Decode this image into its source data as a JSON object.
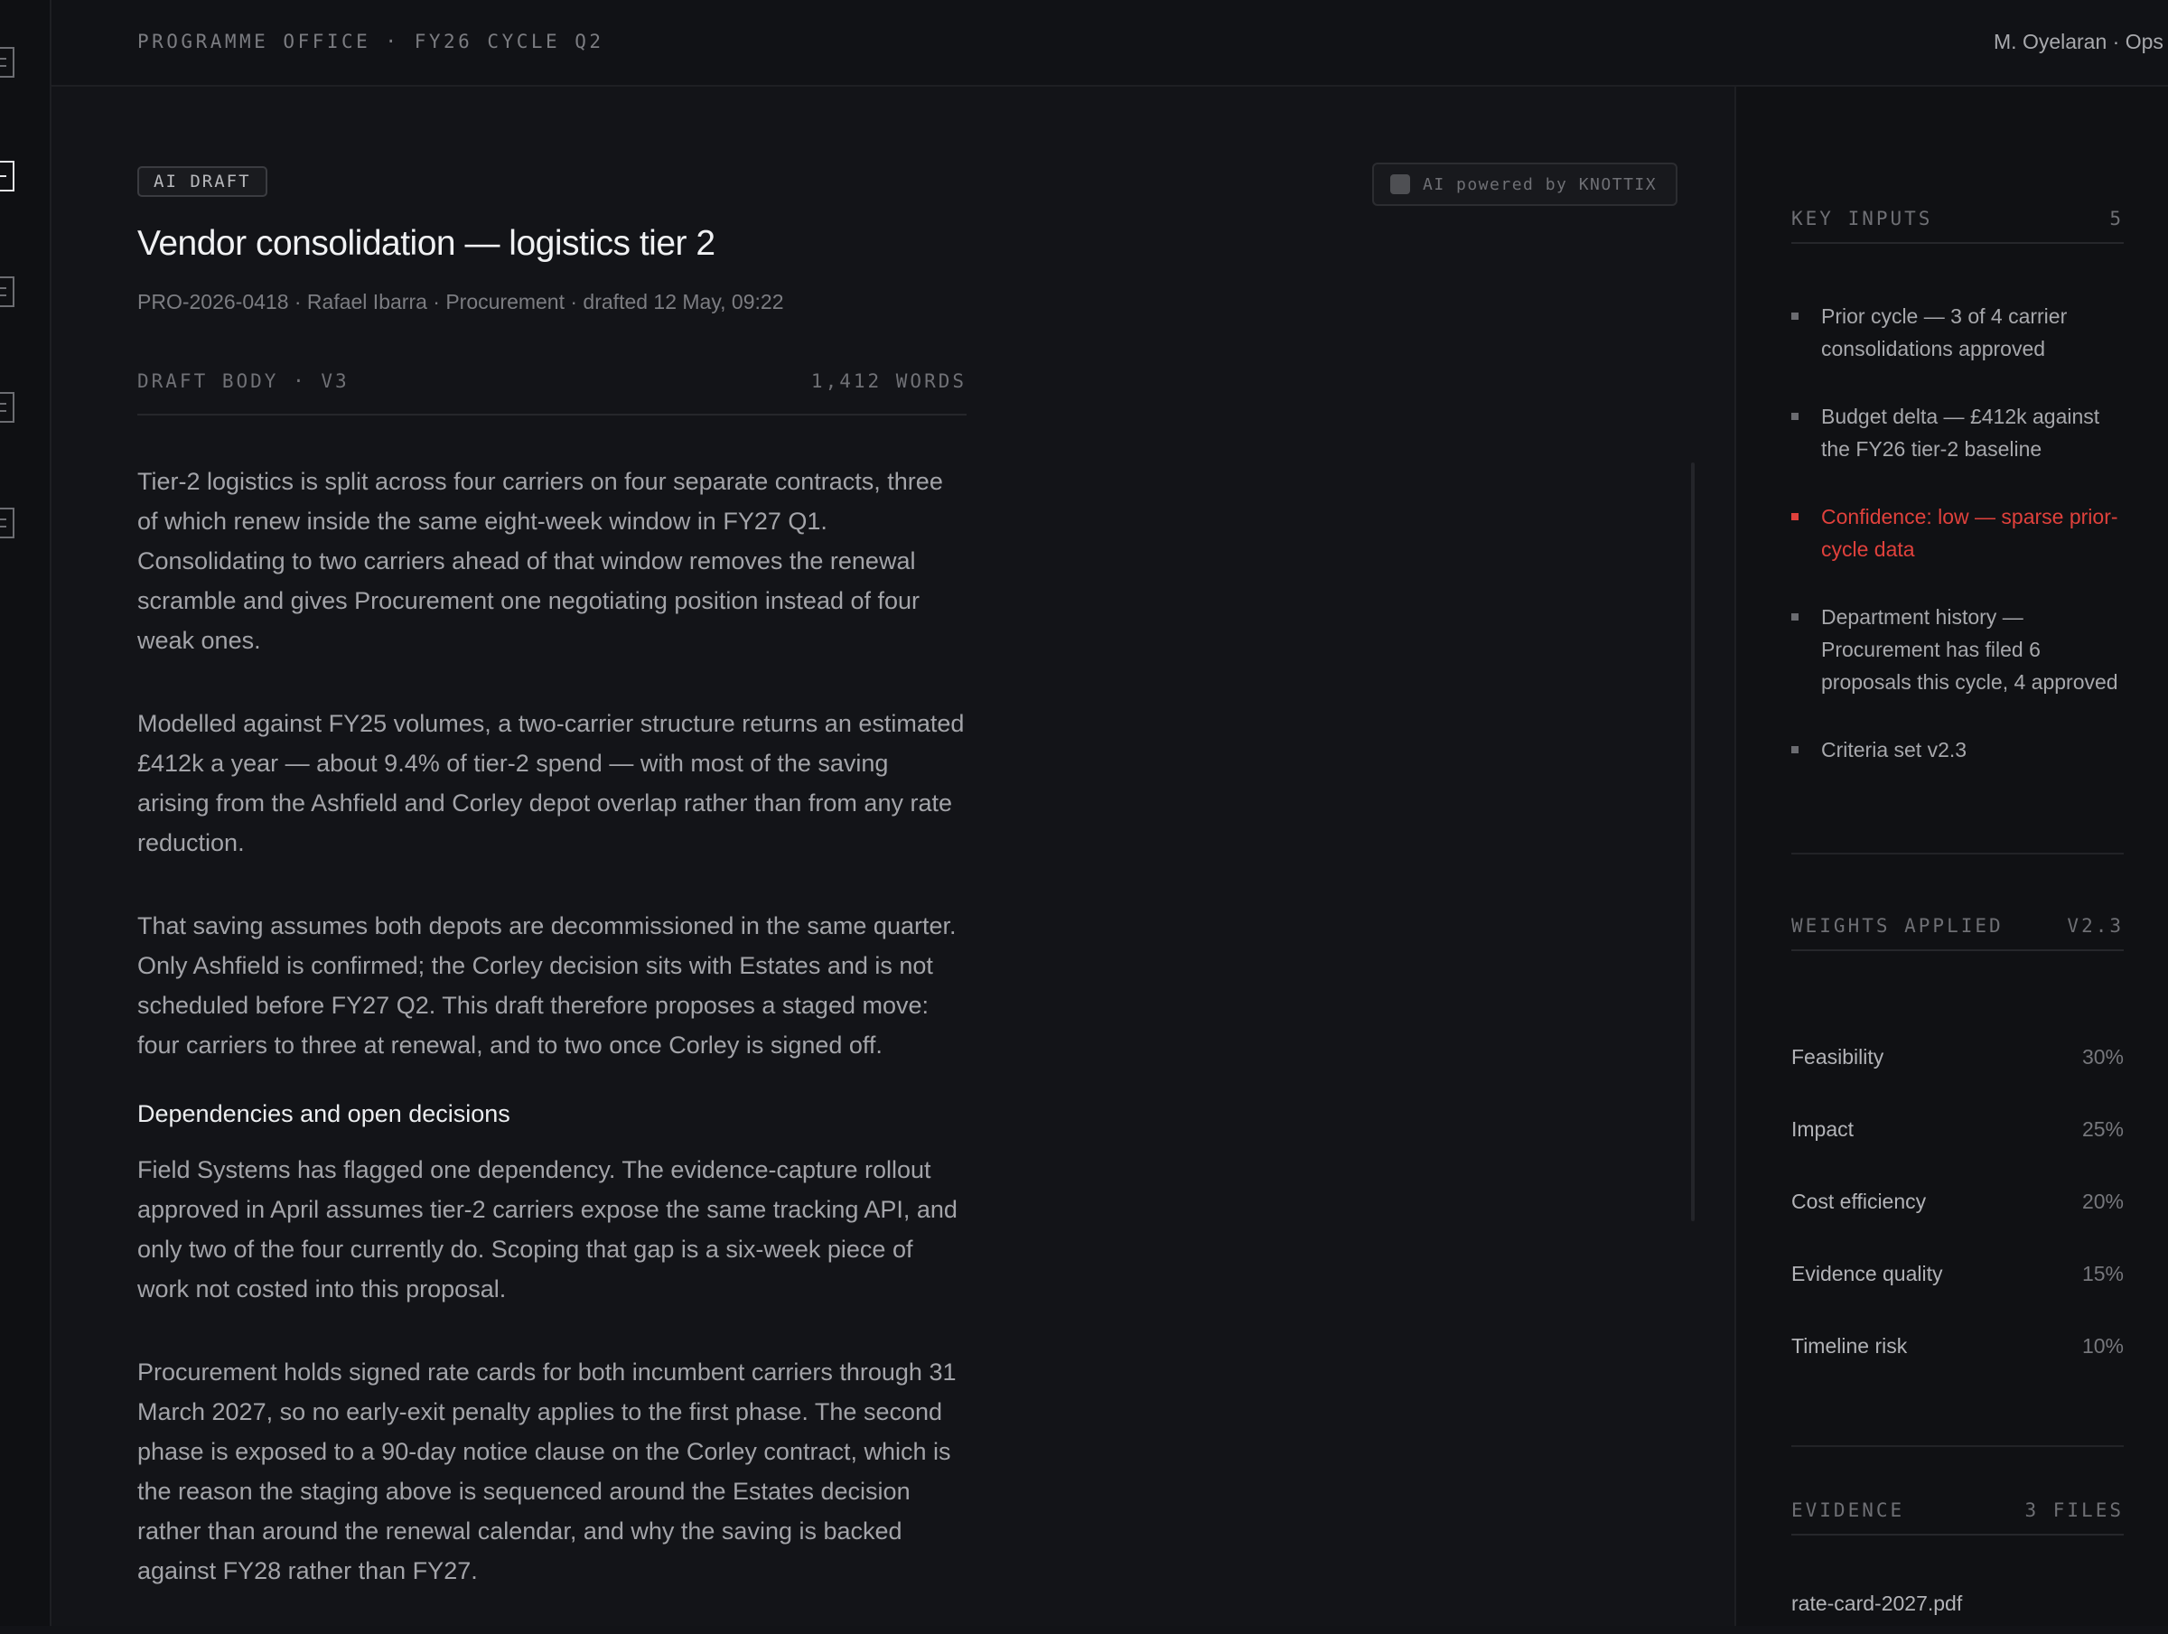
{
  "header": {
    "breadcrumb": "PROGRAMME OFFICE · FY26 CYCLE Q2",
    "user": "M. Oyelaran · Ops"
  },
  "rail": {
    "icons": [
      "list-icon",
      "active-nav-icon",
      "list-icon",
      "list-icon",
      "list-icon"
    ]
  },
  "draft": {
    "badge": "AI DRAFT",
    "powered_by": "AI powered by KNOTTIX",
    "title": "Vendor consolidation — logistics tier 2",
    "meta": "PRO-2026-0418 · Rafael Ibarra · Procurement · drafted 12 May, 09:22",
    "body_label": "DRAFT BODY · V3",
    "word_count": "1,412 WORDS",
    "paragraphs": [
      "Tier-2 logistics is split across four carriers on four separate contracts, three of which renew inside the same eight-week window in FY27 Q1. Consolidating to two carriers ahead of that window removes the renewal scramble and gives Procurement one negotiating position instead of four weak ones.",
      "Modelled against FY25 volumes, a two-carrier structure returns an estimated £412k a year — about 9.4% of tier-2 spend — with most of the saving arising from the Ashfield and Corley depot overlap rather than from any rate reduction.",
      "That saving assumes both depots are decommissioned in the same quarter. Only Ashfield is confirmed; the Corley decision sits with Estates and is not scheduled before FY27 Q2. This draft therefore proposes a staged move: four carriers to three at renewal, and to two once Corley is signed off.",
      "Field Systems has flagged one dependency. The evidence-capture rollout approved in April assumes tier-2 carriers expose the same tracking API, and only two of the four currently do. Scoping that gap is a six-week piece of work not costed into this proposal.",
      "Procurement holds signed rate cards for both incumbent carriers through 31 March 2027, so no early-exit penalty applies to the first phase. The second phase is exposed to a 90-day notice clause on the Corley contract, which is the reason the staging above is sequenced around the Estates decision rather than around the renewal calendar, and why the saving is backed against FY28 rather than FY27."
    ],
    "subheading": "Dependencies and open decisions"
  },
  "side": {
    "key_inputs": {
      "label": "KEY INPUTS",
      "count": "5",
      "items": [
        "Prior cycle — 3 of 4 carrier consolidations approved",
        "Budget delta — £412k against the FY26 tier-2 baseline",
        "Confidence: low — sparse prior-cycle data",
        "Department history — Procurement has filed 6 proposals this cycle, 4 approved",
        "Criteria set v2.3"
      ]
    },
    "weights": {
      "label": "WEIGHTS APPLIED",
      "version": "V2.3",
      "items": [
        {
          "name": "Feasibility",
          "value": "30%"
        },
        {
          "name": "Impact",
          "value": "25%"
        },
        {
          "name": "Cost efficiency",
          "value": "20%"
        },
        {
          "name": "Evidence quality",
          "value": "15%"
        },
        {
          "name": "Timeline risk",
          "value": "10%"
        }
      ]
    },
    "evidence": {
      "label": "EVIDENCE",
      "count": "3 FILES",
      "files": [
        "rate-card-2027.pdf"
      ]
    }
  },
  "colors": {
    "background": "#121317",
    "warning": "#e0413c",
    "heading": "#f0f1f3"
  }
}
